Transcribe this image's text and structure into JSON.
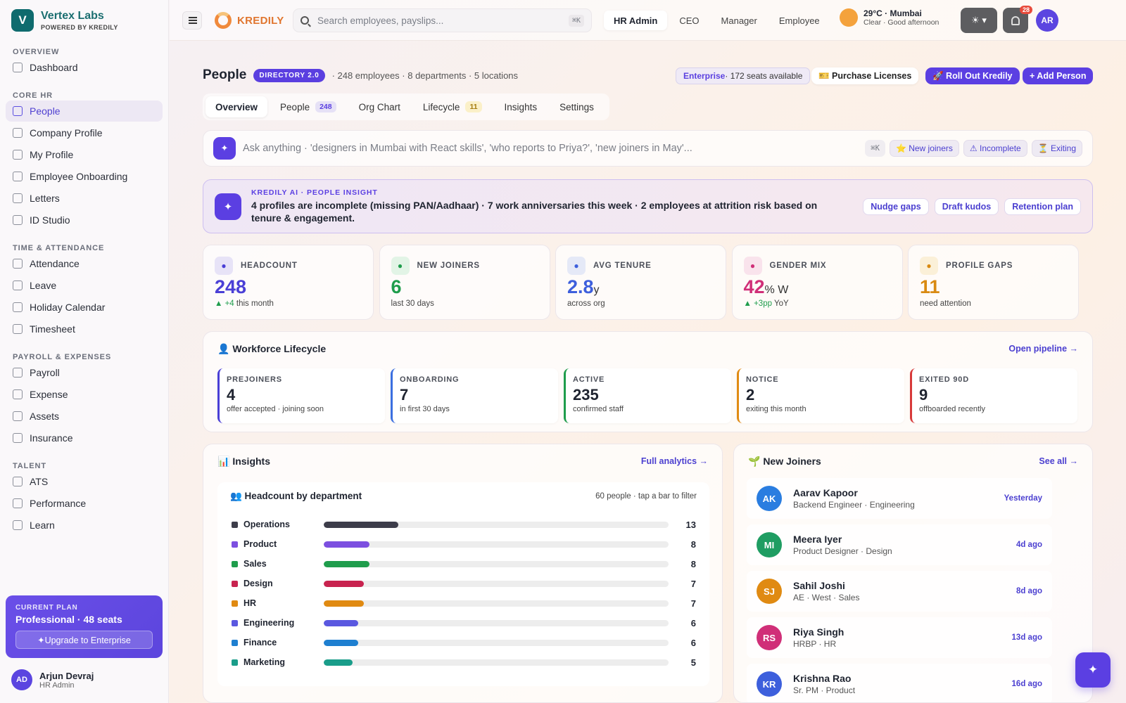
{
  "brand": {
    "name": "Vertex Labs",
    "sub": "POWERED BY KREDILY",
    "logo_letter": "V"
  },
  "sidebar": {
    "sections": [
      {
        "title": "OVERVIEW",
        "items": [
          {
            "label": "Dashboard",
            "icon": "grid-icon"
          }
        ]
      },
      {
        "title": "CORE HR",
        "items": [
          {
            "label": "People",
            "icon": "people-icon",
            "active": true
          },
          {
            "label": "Company Profile",
            "icon": "building-icon"
          },
          {
            "label": "My Profile",
            "icon": "user-icon"
          },
          {
            "label": "Employee Onboarding",
            "icon": "user-plus-icon"
          },
          {
            "label": "Letters",
            "icon": "mail-icon"
          },
          {
            "label": "ID Studio",
            "icon": "id-card-icon"
          }
        ]
      },
      {
        "title": "TIME & ATTENDANCE",
        "items": [
          {
            "label": "Attendance",
            "icon": "clock-icon"
          },
          {
            "label": "Leave",
            "icon": "calendar-icon"
          },
          {
            "label": "Holiday Calendar",
            "icon": "calendar-icon"
          },
          {
            "label": "Timesheet",
            "icon": "clock-icon"
          }
        ]
      },
      {
        "title": "PAYROLL & EXPENSES",
        "items": [
          {
            "label": "Payroll",
            "icon": "money-icon"
          },
          {
            "label": "Expense",
            "icon": "receipt-icon"
          },
          {
            "label": "Assets",
            "icon": "monitor-icon"
          },
          {
            "label": "Insurance",
            "icon": "shield-icon"
          }
        ]
      },
      {
        "title": "TALENT",
        "items": [
          {
            "label": "ATS",
            "icon": "briefcase-icon"
          },
          {
            "label": "Performance",
            "icon": "trophy-icon"
          },
          {
            "label": "Learn",
            "icon": "graduation-icon"
          }
        ]
      }
    ],
    "plan": {
      "label": "CURRENT PLAN",
      "name": "Professional · 48 seats",
      "upgrade": "✦Upgrade to Enterprise"
    },
    "user": {
      "initials": "AD",
      "name": "Arjun Devraj",
      "role": "HR Admin"
    }
  },
  "topbar": {
    "product": "KREDILY",
    "search_placeholder": "Search employees, payslips...",
    "search_shortcut": "⌘K",
    "roles": [
      "HR Admin",
      "CEO",
      "Manager",
      "Employee"
    ],
    "weather": {
      "temp": "29°C · Mumbai",
      "desc": "Clear · Good afternoon"
    },
    "notifications": "28",
    "avatar": "AR"
  },
  "header": {
    "title": "People",
    "badge": "DIRECTORY 2.0",
    "meta": "· 248 employees · 8 departments · 5 locations",
    "plan_name": "Enterprise",
    "plan_rest": " · 172 seats available",
    "purchase": "🎫 Purchase Licenses",
    "rollout": "🚀 Roll Out Kredily",
    "add": "+ Add Person"
  },
  "tabs": [
    {
      "label": "Overview",
      "active": true
    },
    {
      "label": "People",
      "count": "248",
      "style": "purple"
    },
    {
      "label": "Org Chart"
    },
    {
      "label": "Lifecycle",
      "count": "11",
      "style": "yellow"
    },
    {
      "label": "Insights"
    },
    {
      "label": "Settings"
    }
  ],
  "ask": {
    "placeholder": "Ask anything · 'designers in Mumbai with React skills', 'who reports to Priya?', 'new joiners in May'...",
    "shortcut": "⌘K",
    "chips": [
      "⭐ New joiners",
      "⚠ Incomplete",
      "⏳ Exiting"
    ]
  },
  "ai_insight": {
    "label": "KREDILY AI · PEOPLE INSIGHT",
    "text": "4 profiles are incomplete (missing PAN/Aadhaar) · 7 work anniversaries this week · 2 employees at attrition risk based on tenure & engagement.",
    "actions": [
      "Nudge gaps",
      "Draft kudos",
      "Retention plan"
    ]
  },
  "kpis": [
    {
      "label": "HEADCOUNT",
      "value": "248",
      "unit": "",
      "delta": "▲ +4",
      "sub": " this month",
      "color": "#4a3fd6",
      "icon": "people-icon",
      "icon_bg": "#e7e3f7"
    },
    {
      "label": "NEW JOINERS",
      "value": "6",
      "unit": "",
      "delta": "",
      "sub": "last 30 days",
      "color": "#1f9d4c",
      "icon": "sprout-icon",
      "icon_bg": "#e2f4e6"
    },
    {
      "label": "AVG TENURE",
      "value": "2.8",
      "unit": "y",
      "delta": "",
      "sub": "across org",
      "color": "#3d5fdc",
      "icon": "timer-icon",
      "icon_bg": "#e5e9f7"
    },
    {
      "label": "GENDER MIX",
      "value": "42",
      "unit": "% W",
      "delta": "▲ +3pp",
      "sub": " YoY",
      "color": "#d02f78",
      "icon": "gender-icon",
      "icon_bg": "#f9e3ec"
    },
    {
      "label": "PROFILE GAPS",
      "value": "11",
      "unit": "",
      "delta": "",
      "sub": "need attention",
      "color": "#d98a12",
      "icon": "warning-icon",
      "icon_bg": "#fbf0d8"
    }
  ],
  "lifecycle": {
    "title": "👤 Workforce Lifecycle",
    "link": "Open pipeline →",
    "stages": [
      {
        "label": "PREJOINERS",
        "value": "4",
        "sub": "offer accepted · joining soon",
        "color": "#4a3fd6"
      },
      {
        "label": "ONBOARDING",
        "value": "7",
        "sub": "in first 30 days",
        "color": "#3b6fe0"
      },
      {
        "label": "ACTIVE",
        "value": "235",
        "sub": "confirmed staff",
        "color": "#1f9d4c"
      },
      {
        "label": "NOTICE",
        "value": "2",
        "sub": "exiting this month",
        "color": "#e08a12"
      },
      {
        "label": "EXITED 90D",
        "value": "9",
        "sub": "offboarded recently",
        "color": "#d83a3a"
      }
    ]
  },
  "insights": {
    "title": "📊 Insights",
    "link": "Full analytics →",
    "dept_title": "👥 Headcount by department",
    "dept_note": "60 people · tap a bar to filter",
    "max": 60
  },
  "chart_data": {
    "type": "bar",
    "categories": [
      "Operations",
      "Product",
      "Sales",
      "Design",
      "HR",
      "Engineering",
      "Finance",
      "Marketing"
    ],
    "values": [
      13,
      8,
      8,
      7,
      7,
      6,
      6,
      5
    ],
    "colors": [
      "#3d3d4a",
      "#7c4fe0",
      "#1f9d4c",
      "#c8234f",
      "#e08a12",
      "#5a58e0",
      "#1e7fd0",
      "#1a9d8a"
    ],
    "title": "👥 Headcount by department"
  },
  "joiners": {
    "title": "🌱 New Joiners",
    "link": "See all →",
    "items": [
      {
        "initials": "AK",
        "name": "Aarav Kapoor",
        "role": "Backend Engineer · Engineering",
        "when": "Yesterday",
        "color": "#2a7de0"
      },
      {
        "initials": "MI",
        "name": "Meera Iyer",
        "role": "Product Designer · Design",
        "when": "4d ago",
        "color": "#1f9d62"
      },
      {
        "initials": "SJ",
        "name": "Sahil Joshi",
        "role": "AE · West · Sales",
        "when": "8d ago",
        "color": "#e08a12"
      },
      {
        "initials": "RS",
        "name": "Riya Singh",
        "role": "HRBP · HR",
        "when": "13d ago",
        "color": "#d02f78"
      },
      {
        "initials": "KR",
        "name": "Krishna Rao",
        "role": "Sr. PM · Product",
        "when": "16d ago",
        "color": "#3d5fdc"
      }
    ]
  },
  "fab": "✦"
}
